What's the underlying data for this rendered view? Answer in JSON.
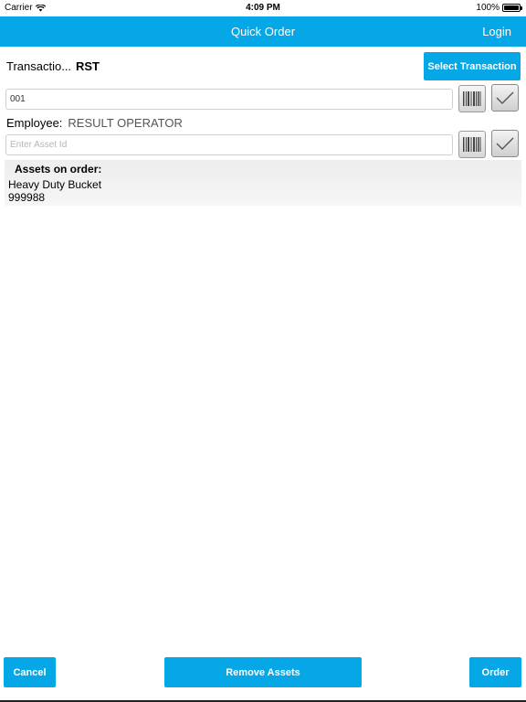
{
  "status_bar": {
    "carrier": "Carrier",
    "time": "4:09 PM",
    "battery": "100%"
  },
  "nav": {
    "title": "Quick Order",
    "login": "Login"
  },
  "transaction": {
    "label": "Transactio...",
    "value": "RST",
    "select_button": "Select Transaction"
  },
  "employee_input": {
    "value": "001"
  },
  "employee": {
    "label": "Employee:",
    "value": "RESULT OPERATOR"
  },
  "asset_input": {
    "value": "",
    "placeholder": "Enter Asset Id"
  },
  "assets": {
    "heading": "Assets on order:",
    "items": [
      {
        "name": "Heavy Duty Bucket",
        "id": "999988"
      }
    ]
  },
  "footer": {
    "cancel": "Cancel",
    "remove": "Remove Assets",
    "order": "Order"
  },
  "colors": {
    "accent": "#05a7e6"
  }
}
